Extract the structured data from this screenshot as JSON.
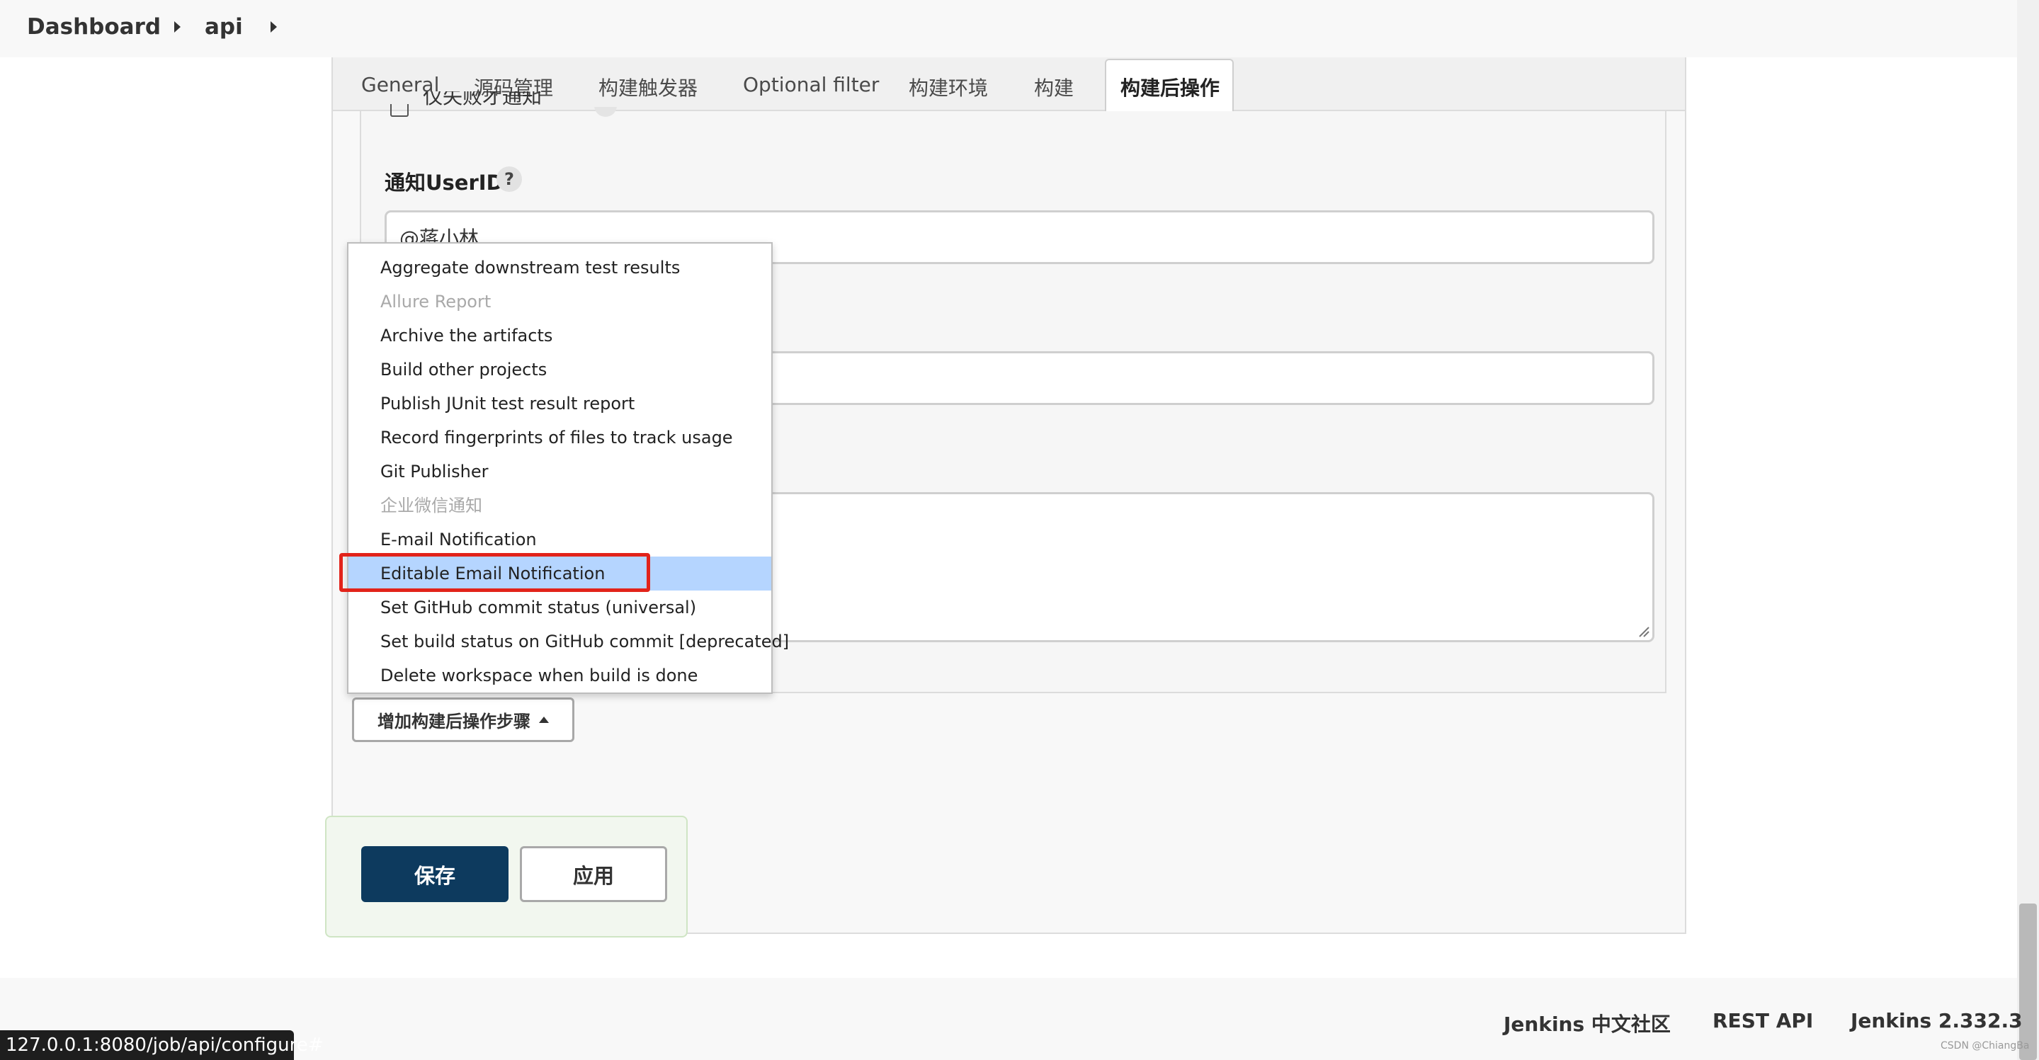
{
  "breadcrumb": {
    "items": [
      "Dashboard",
      "api"
    ]
  },
  "tabs": [
    {
      "label": "General"
    },
    {
      "label": "源码管理"
    },
    {
      "label": "构建触发器"
    },
    {
      "label": "Optional filter"
    },
    {
      "label": "构建环境"
    },
    {
      "label": "构建"
    },
    {
      "label": "构建后操作",
      "active": true
    }
  ],
  "form": {
    "clipped_checkbox_label": "仅失败才通知",
    "userid_label": "通知UserID",
    "userid_value": "@蒋小林",
    "help_symbol": "?"
  },
  "menu": {
    "items": [
      {
        "label": "Aggregate downstream test results",
        "disabled": false
      },
      {
        "label": "Allure Report",
        "disabled": true
      },
      {
        "label": "Archive the artifacts",
        "disabled": false
      },
      {
        "label": "Build other projects",
        "disabled": false
      },
      {
        "label": "Publish JUnit test result report",
        "disabled": false
      },
      {
        "label": "Record fingerprints of files to track usage",
        "disabled": false
      },
      {
        "label": "Git Publisher",
        "disabled": false
      },
      {
        "label": "企业微信通知",
        "disabled": true
      },
      {
        "label": "E-mail Notification",
        "disabled": false
      },
      {
        "label": "Editable Email Notification",
        "disabled": false,
        "highlighted": true
      },
      {
        "label": "Set GitHub commit status (universal)",
        "disabled": false
      },
      {
        "label": "Set build status on GitHub commit [deprecated]",
        "disabled": false
      },
      {
        "label": "Delete workspace when build is done",
        "disabled": false
      }
    ]
  },
  "add_step_button": "增加构建后操作步骤",
  "actions": {
    "save": "保存",
    "apply": "应用"
  },
  "footer": {
    "community": "Jenkins 中文社区",
    "rest_api": "REST API",
    "version": "Jenkins 2.332.3"
  },
  "status_url": "127.0.0.1:8080/job/api/configure#",
  "watermark": "CSDN @ChiangBa",
  "colors": {
    "save_button": "#0d3a5e",
    "menu_highlight": "#b5d5ff",
    "highlight_box": "#e2231a"
  }
}
